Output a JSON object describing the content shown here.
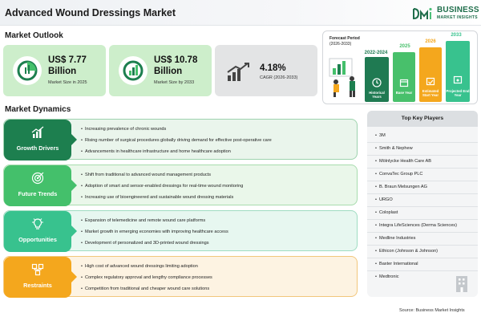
{
  "title": "Advanced Wound Dressings Market",
  "logo": {
    "line1": "BUSINESS",
    "line2": "MARKET INSIGHTS",
    "icon": "bmi-logo-icon"
  },
  "outlook": {
    "heading": "Market Outlook",
    "cards": [
      {
        "value": "US$ 7.77 Billion",
        "label": "Market Size in 2025",
        "icon": "pie-chart-icon",
        "color": "#cdeecb"
      },
      {
        "value": "US$ 10.78 Billion",
        "label": "Market Size by 2033",
        "icon": "bar-chart-icon",
        "color": "#cdeecb"
      },
      {
        "value": "4.18%",
        "label": "CAGR (2026-2033)",
        "icon": "trend-up-icon",
        "color": "#e3e4e5"
      }
    ]
  },
  "forecast": {
    "title": "Forecast Period",
    "range": "(2026-2033)",
    "bars": [
      {
        "year": "2022-2024",
        "caption": "Historical Years",
        "color": "#1f7a52"
      },
      {
        "year": "2025",
        "caption": "Base Year",
        "color": "#48c06b"
      },
      {
        "year": "2026",
        "caption": "Estimated Start Year",
        "color": "#f4a71d"
      },
      {
        "year": "2033",
        "caption": "Projected End Year",
        "color": "#38c28e"
      }
    ]
  },
  "dynamics": {
    "heading": "Market Dynamics",
    "rows": [
      {
        "label": "Growth Drivers",
        "color": "#1d7f4f",
        "bg": "#eaf5ec",
        "icon": "growth-chart-icon",
        "items": [
          "Increasing prevalence of chronic wounds",
          "Rising number of surgical procedures globally driving demand for effective post-operative care",
          "Advancements in healthcare infrastructure and home healthcare adoption"
        ]
      },
      {
        "label": "Future Trends",
        "color": "#44c06b",
        "bg": "#eaf7ea",
        "icon": "target-icon",
        "items": [
          "Shift from traditional to advanced wound management products",
          "Adoption of smart and sensor-enabled dressings for real-time wound monitoring",
          "Increasing use of bioengineered and sustainable wound dressing materials"
        ]
      },
      {
        "label": "Opportunities",
        "color": "#38c28e",
        "bg": "#e7f7f0",
        "icon": "lightbulb-icon",
        "items": [
          "Expansion of telemedicine and remote wound care platforms",
          "Market growth in emerging economies with improving healthcare access",
          "Development of personalized and 3D-printed wound dressings"
        ]
      },
      {
        "label": "Restraints",
        "color": "#f4a71d",
        "bg": "#fdf3e2",
        "icon": "network-icon",
        "items": [
          "High cost of advanced wound dressings limiting adoption",
          "Complex regulatory approval and lengthy compliance processes",
          "Competition from traditional and cheaper wound care solutions"
        ]
      }
    ]
  },
  "players": {
    "heading": "Top Key Players",
    "list": [
      "3M",
      "Smith & Nephew",
      "Mölnlycke Health Care AB",
      "ConvaTec Group PLC",
      "B. Braun Melsungen AG",
      "URGO",
      "Coloplast",
      "Integra LifeSciences (Derma Sciences)",
      "Medline Industries",
      "Ethicon (Johnson & Johnson)",
      "Baxter International",
      "Medtronic"
    ]
  },
  "source": "Source: Business Market Insights"
}
